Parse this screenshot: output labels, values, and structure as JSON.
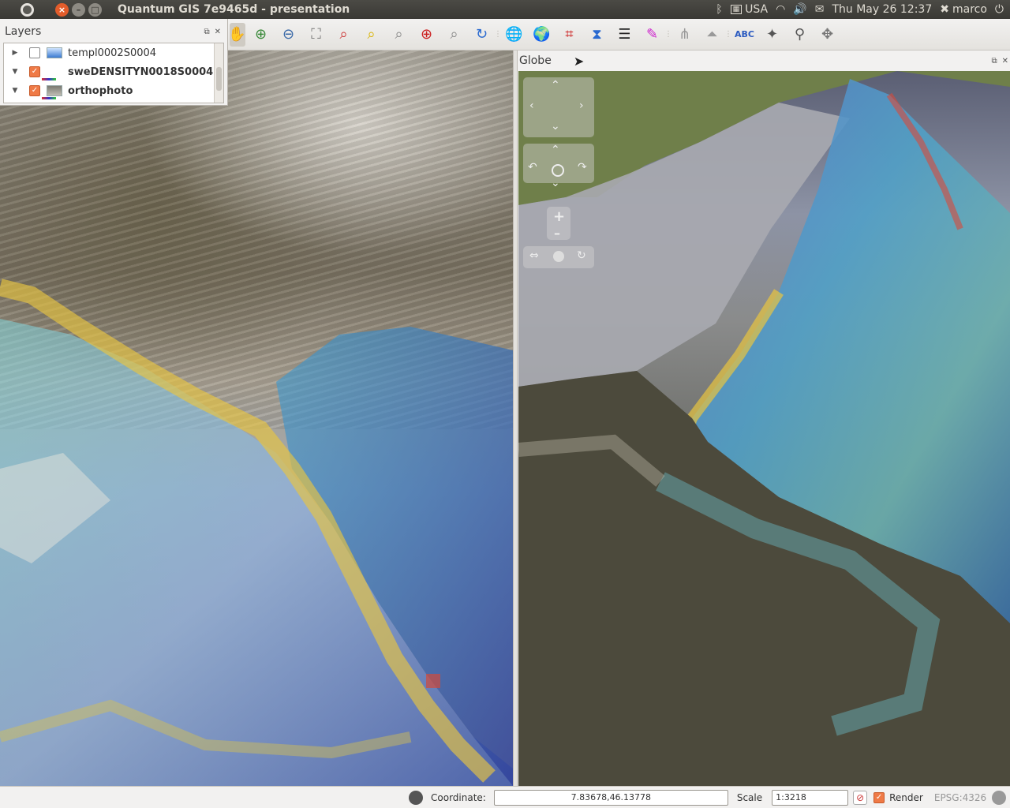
{
  "topbar": {
    "window_title": "Quantum GIS 7e9465d - presentation",
    "keyboard_layout": "USA",
    "datetime": "Thu May 26 12:37",
    "user": "marco"
  },
  "layers_panel": {
    "title": "Layers",
    "layers": [
      {
        "name": "templ0002S0004",
        "checked": false,
        "bold": false
      },
      {
        "name": "sweDENSITYN0018S0004",
        "checked": true,
        "bold": true
      },
      {
        "name": "orthophoto",
        "checked": true,
        "bold": true
      }
    ]
  },
  "globe_panel": {
    "title": "Globe"
  },
  "toolbar": {
    "icons": [
      "pan-icon",
      "zoom-in-icon",
      "zoom-out-icon",
      "zoom-full-icon",
      "zoom-selection-icon",
      "zoom-layer-icon",
      "zoom-native-icon",
      "zoom-last-icon",
      "zoom-next-icon",
      "refresh-icon",
      "globe-icon",
      "globe-settings-icon",
      "graticule-icon",
      "gps-icon",
      "layer-stack-icon",
      "color-icon",
      "profile-icon",
      "terrain-icon",
      "label-icon",
      "node-tool-icon",
      "pin-icon",
      "move-label-icon"
    ]
  },
  "statusbar": {
    "coordinate_label": "Coordinate:",
    "coordinate_value": "7.83678,46.13778",
    "scale_label": "Scale",
    "scale_value": "1:3218",
    "render_label": "Render",
    "crs": "EPSG:4326"
  }
}
